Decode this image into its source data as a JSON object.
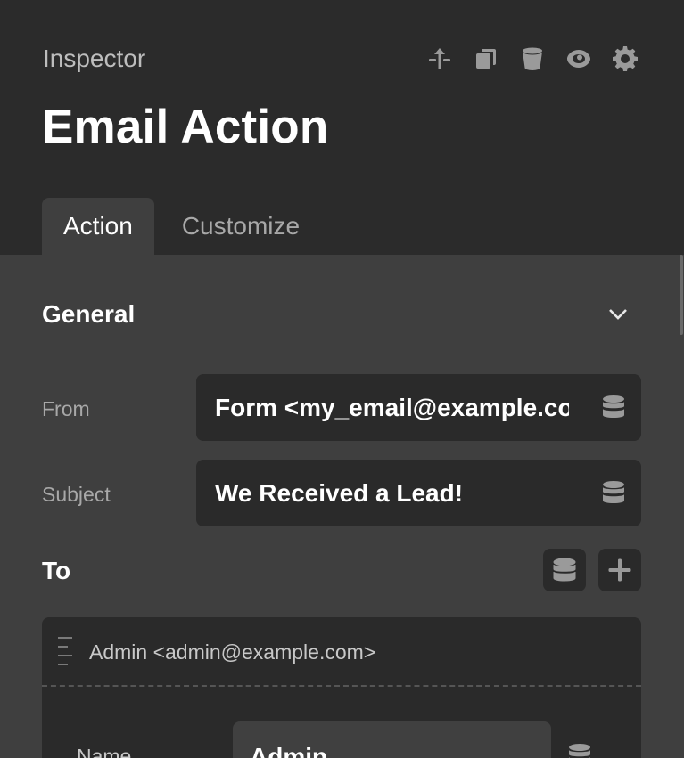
{
  "header": {
    "label": "Inspector",
    "title": "Email Action",
    "toolbar": [
      {
        "icon": "move-up-icon"
      },
      {
        "icon": "duplicate-icon"
      },
      {
        "icon": "delete-bucket-icon"
      },
      {
        "icon": "eye-icon"
      },
      {
        "icon": "gear-icon"
      }
    ]
  },
  "tabs": [
    {
      "label": "Action",
      "active": true
    },
    {
      "label": "Customize",
      "active": false
    }
  ],
  "general": {
    "title": "General",
    "from_label": "From",
    "from_value": "Form <my_email@example.com>",
    "subject_label": "Subject",
    "subject_value": "We Received a Lead!"
  },
  "to": {
    "label": "To",
    "recipients": [
      {
        "title": "Admin <admin@example.com>",
        "name_label": "Name",
        "name_value": "Admin"
      }
    ]
  },
  "colors": {
    "header_bg": "#2b2b2b",
    "panel_bg": "#3f3f3f",
    "field_bg": "#2a2a2a",
    "icon": "#9a9a9a"
  }
}
